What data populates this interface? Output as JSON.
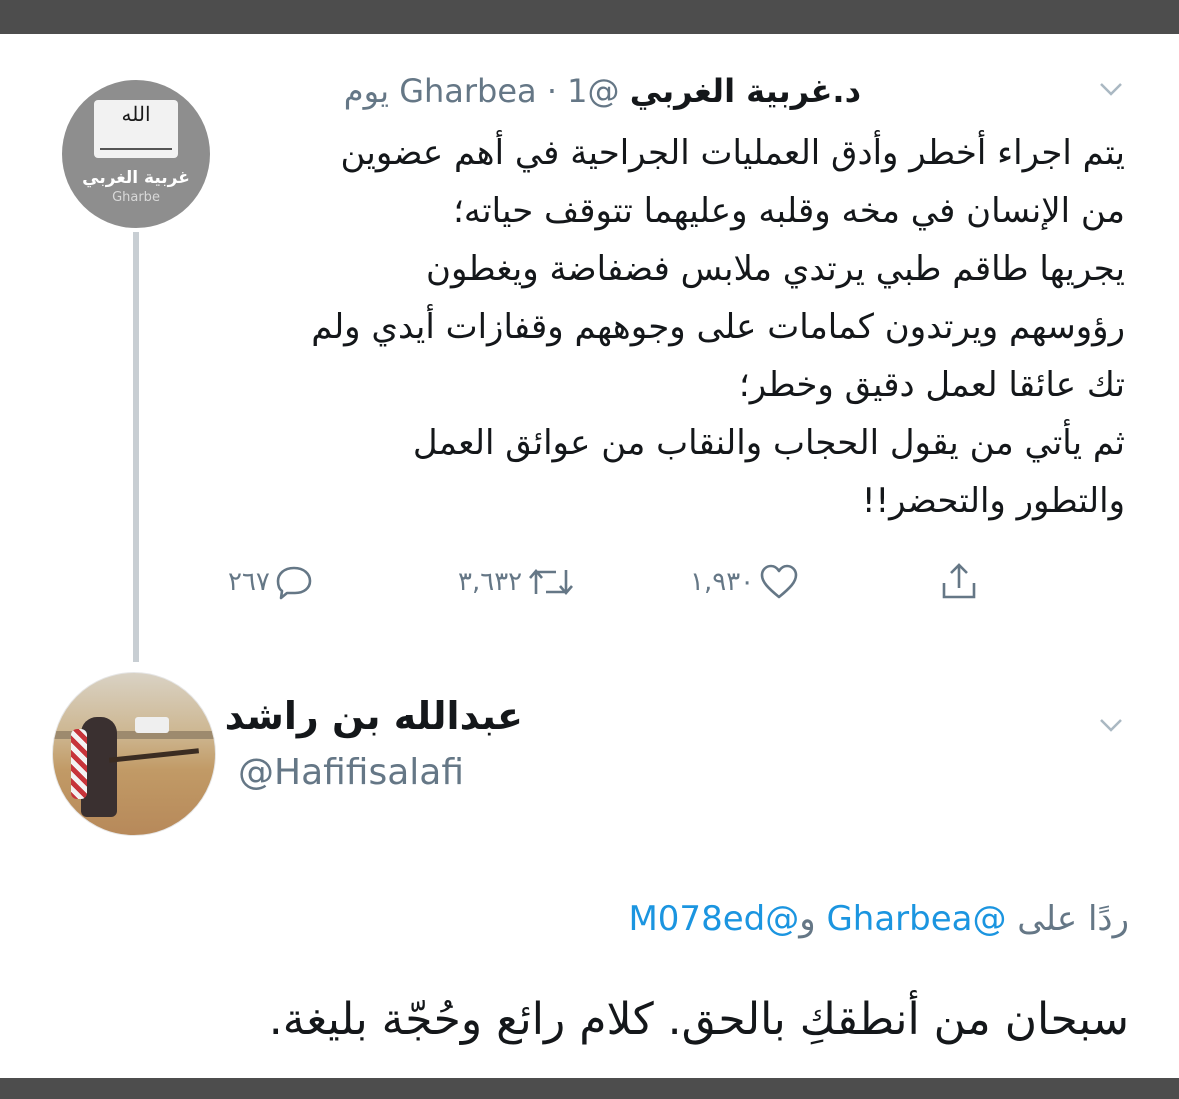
{
  "tweet1": {
    "avatar": {
      "logo_text": "الله",
      "name_text": "غربية الغربي",
      "handle_text": "Gharbe"
    },
    "display_name": "د.غربية الغربي",
    "handle": "@Gharbea",
    "separator": "·",
    "time": "1 يوم",
    "icon_caret": "chevron-down-icon",
    "body_lines": [
      "يتم اجراء أخطر وأدق العمليات الجراحية في أهم عضوين",
      "من الإنسان في مخه وقلبه وعليهما تتوقف حياته؛",
      "يجريها طاقم طبي يرتدي ملابس فضفاضة ويغطون",
      "رؤوسهم ويرتدون كمامات على وجوههم وقفازات أيدي ولم",
      "تك عائقا لعمل دقيق وخطر؛",
      "ثم يأتي من يقول الحجاب والنقاب من عوائق العمل",
      "والتطور والتحضر!!"
    ],
    "actions": {
      "replies": "٢٦٧",
      "retweets": "٣,٦٣٢",
      "likes": "١,٩٣٠",
      "icons": [
        "reply-icon",
        "retweet-icon",
        "like-icon",
        "share-icon"
      ]
    }
  },
  "tweet2": {
    "display_name": "عبدالله بن راشد",
    "handle": "@Hafifisalafi",
    "icon_caret": "chevron-down-icon",
    "reply_prefix": "ردًا على",
    "reply_mention_1": "@Gharbea",
    "reply_and": "و",
    "reply_mention_2": "@M078ed",
    "text": "سبحان من أنطقكِ بالحق. كلام رائع وحُجّة بليغة."
  },
  "colors": {
    "text_primary": "#14171a",
    "text_secondary": "#657786",
    "link": "#1b95e0",
    "thread_line": "#c8ced3",
    "frame": "#4d4d4d"
  }
}
